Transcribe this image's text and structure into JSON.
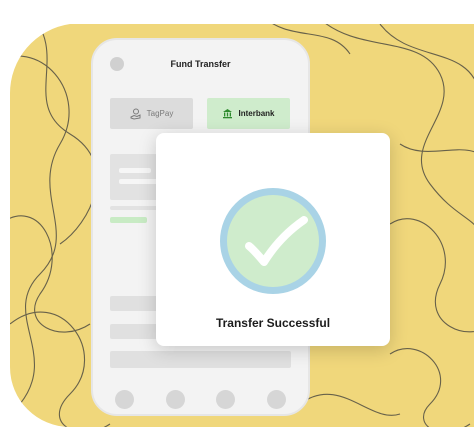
{
  "app": {
    "title": "Fund Transfer",
    "tabs": [
      {
        "label": "TagPay",
        "icon": "hand-coin-icon",
        "selected": false
      },
      {
        "label": "Interbank",
        "icon": "bank-icon",
        "selected": true
      }
    ]
  },
  "modal": {
    "icon": "checkmark-icon",
    "message": "Transfer Successful"
  },
  "colors": {
    "background_blob": "#f0d77b",
    "blob_lines": "#3a3a3a",
    "success_green": "#cfeccc",
    "ring_blue": "#a9d3e6"
  }
}
